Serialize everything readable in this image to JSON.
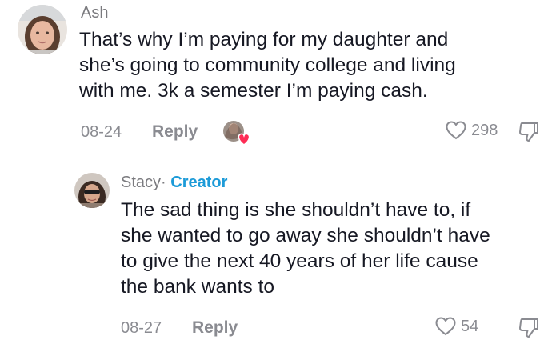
{
  "comments": [
    {
      "username": "Ash",
      "text_lines": [
        "That’s why I’m paying for my daughter and",
        "she’s going to community college and living",
        "with me. 3k a semester I’m paying cash."
      ],
      "date": "08-24",
      "reply_label": "Reply",
      "like_count": "298",
      "liked_by_creator": true
    },
    {
      "username": "Stacy",
      "separator": "·",
      "creator_label": "Creator",
      "text_lines": [
        "The sad thing is she shouldn’t have to, if",
        "she wanted to go away she shouldn’t have",
        "to give the next 40 years of her life cause",
        "the bank wants to"
      ],
      "date": "08-27",
      "reply_label": "Reply",
      "like_count": "54"
    }
  ],
  "icons": {
    "like": "heart-outline-icon",
    "dislike": "thumbs-down-icon",
    "creator_liked": "creator-liked-heart-icon"
  },
  "colors": {
    "creator": "#1d9bd8",
    "liked_heart": "#fe2c55",
    "muted": "#8a8b91"
  }
}
